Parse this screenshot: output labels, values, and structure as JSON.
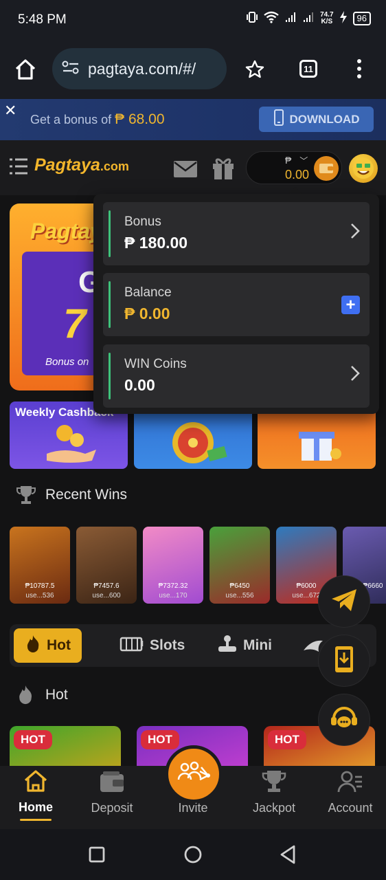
{
  "status_bar": {
    "time": "5:48 PM",
    "net_speed_value": "74.7",
    "net_speed_unit": "K/S",
    "battery": "96"
  },
  "browser": {
    "url": "pagtaya.com/#/",
    "tab_count": "11"
  },
  "banner": {
    "text_prefix": "Get a bonus of",
    "amount": "₱ 68.00",
    "download_label": "DOWNLOAD"
  },
  "header": {
    "logo_main": "Pagtaya",
    "logo_suffix": ".com",
    "currency": "₱",
    "balance": "0.00"
  },
  "promo": {
    "title": "Pagtaya",
    "big_letter": "G",
    "big_number": "7",
    "caption": "Bonus on"
  },
  "feature_cards": [
    {
      "label": "Weekly Cashback"
    },
    {
      "label": ""
    },
    {
      "label": ""
    }
  ],
  "recent_wins": {
    "title": "Recent Wins",
    "items": [
      {
        "amount": "₱10787.5",
        "user": "use...536",
        "color1": "#c9741e",
        "color2": "#6a2a11"
      },
      {
        "amount": "₱7457.6",
        "user": "use...600",
        "color1": "#8a5b35",
        "color2": "#3b2415"
      },
      {
        "amount": "₱7372.32",
        "user": "use...170",
        "color1": "#f28bc6",
        "color2": "#a14bd1"
      },
      {
        "amount": "₱6450",
        "user": "use...556",
        "color1": "#49a13b",
        "color2": "#9b2a2a"
      },
      {
        "amount": "₱6000",
        "user": "use...672",
        "color1": "#2d7bbf",
        "color2": "#c22a1a"
      },
      {
        "amount": "₱6660",
        "user": "",
        "color1": "#6a5bb0",
        "color2": "#2c2a55"
      }
    ]
  },
  "game_tabs": [
    {
      "label": "Hot"
    },
    {
      "label": "Slots"
    },
    {
      "label": "Mini"
    }
  ],
  "hot_section": {
    "title": "Hot",
    "badge": "HOT",
    "games": [
      {
        "color1": "#3fa52b",
        "color2": "#c2a41c"
      },
      {
        "color1": "#7a2fc0",
        "color2": "#c33fd0"
      },
      {
        "color1": "#b3261c",
        "color2": "#e6a12a"
      }
    ]
  },
  "dropdown": {
    "items": [
      {
        "label": "Bonus",
        "value": "₱ 180.00"
      },
      {
        "label": "Balance",
        "value": "₱ 0.00"
      },
      {
        "label": "WIN Coins",
        "value": "0.00"
      }
    ]
  },
  "bottom_nav": {
    "items": [
      {
        "label": "Home"
      },
      {
        "label": "Deposit"
      },
      {
        "label": "Invite"
      },
      {
        "label": "Jackpot"
      },
      {
        "label": "Account"
      }
    ]
  },
  "colors": {
    "accent_gold": "#f0b62f",
    "accent_green": "#3ec27a",
    "accent_blue": "#3f6ff2",
    "invite_orange": "#f08a16"
  }
}
